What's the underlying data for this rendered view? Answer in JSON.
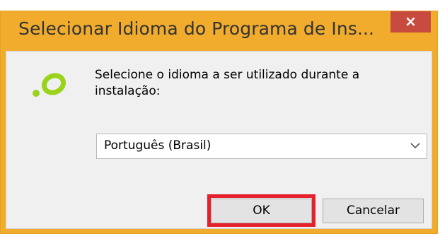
{
  "dialog": {
    "title": "Selecionar Idioma do Programa de Ins...",
    "close_label": "×",
    "message": "Selecione o idioma a ser utilizado durante a instalação:",
    "logo_icon": "setup-logo-icon",
    "language_select": {
      "selected": "Português (Brasil)",
      "arrow_icon": "chevron-down-icon"
    },
    "ok_label": "OK",
    "cancel_label": "Cancelar",
    "colors": {
      "title_bar": "#f1ac2d",
      "close_button": "#c74b3f",
      "highlight": "#e5202a",
      "logo": "#9bd31c"
    }
  }
}
